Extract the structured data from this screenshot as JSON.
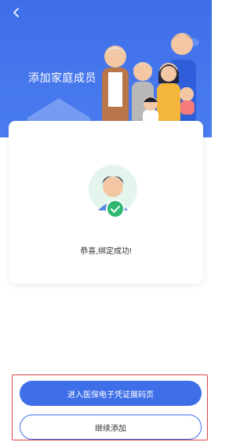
{
  "header": {
    "back_icon": "chevron-left-icon",
    "title": "添加家庭成员",
    "background_color": "#4a7cf0"
  },
  "card": {
    "avatar_icon": "user-avatar-icon",
    "status_icon": "check-circle-icon",
    "message": "恭喜,绑定成功!",
    "status_color": "#2eb872"
  },
  "actions": {
    "primary_label": "进入医保电子凭证展码页",
    "secondary_label": "继续添加",
    "accent_color": "#3f6fe8",
    "highlight_color": "#e04545"
  }
}
